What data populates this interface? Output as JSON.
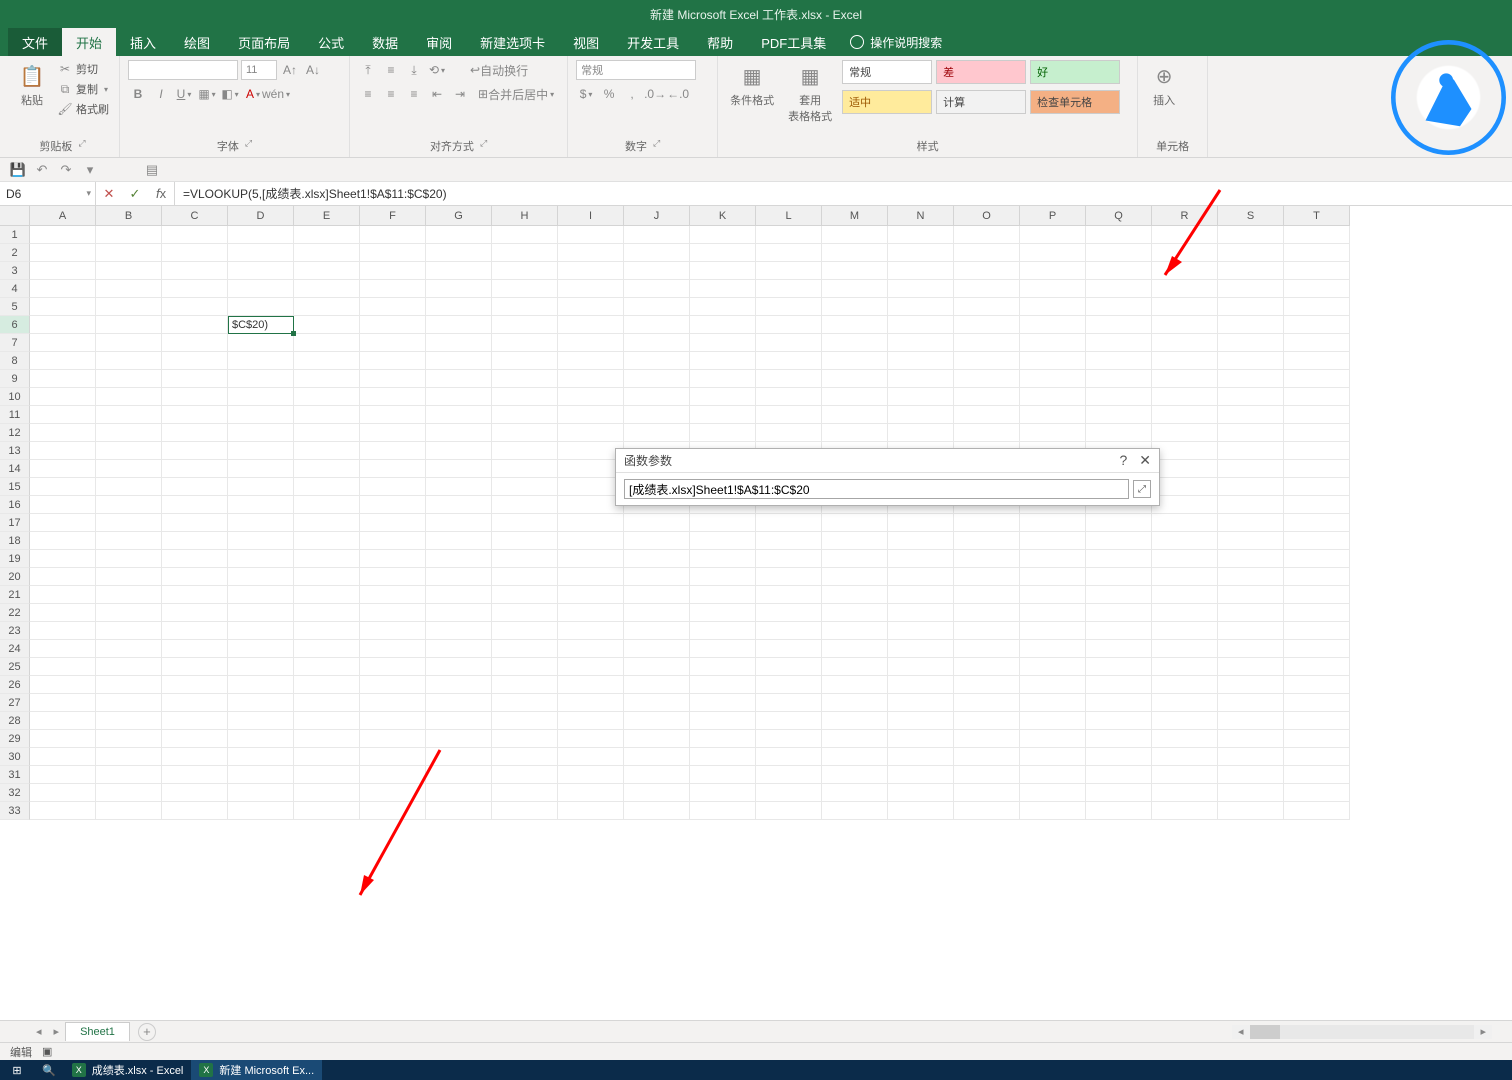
{
  "title": "新建 Microsoft Excel 工作表.xlsx  -  Excel",
  "tabs": {
    "file": "文件",
    "home": "开始",
    "insert": "插入",
    "draw": "绘图",
    "layout": "页面布局",
    "formulas": "公式",
    "data": "数据",
    "review": "审阅",
    "newtab": "新建选项卡",
    "view": "视图",
    "dev": "开发工具",
    "help": "帮助",
    "pdf": "PDF工具集",
    "tellme": "操作说明搜索"
  },
  "ribbon": {
    "clipboard": {
      "paste": "粘贴",
      "cut": "剪切",
      "copy": "复制",
      "format_painter": "格式刷",
      "label": "剪贴板"
    },
    "font": {
      "label": "字体",
      "size": "11"
    },
    "align": {
      "label": "对齐方式",
      "wrap": "自动换行",
      "merge": "合并后居中"
    },
    "number": {
      "label": "数字",
      "general": "常规"
    },
    "styles": {
      "label": "样式",
      "cond": "条件格式",
      "table": "套用\n表格格式",
      "normal": "常规",
      "bad": "差",
      "good": "好",
      "neutral": "适中",
      "calc": "计算",
      "check": "检查单元格"
    },
    "cells": {
      "label": "单元格",
      "insert": "插入"
    }
  },
  "namebox": "D6",
  "formula": "=VLOOKUP(5,[成绩表.xlsx]Sheet1!$A$11:$C$20)",
  "columns": [
    "A",
    "B",
    "C",
    "D",
    "E",
    "F",
    "G",
    "H",
    "I",
    "J",
    "K",
    "L",
    "M",
    "N",
    "O",
    "P",
    "Q",
    "R",
    "S",
    "T"
  ],
  "row_count": 33,
  "active_cell": {
    "row": 6,
    "col": "D",
    "display": "$C$20)"
  },
  "dialog": {
    "title": "函数参数",
    "value": "[成绩表.xlsx]Sheet1!$A$11:$C$20"
  },
  "sheet": {
    "name": "Sheet1"
  },
  "status": {
    "mode": "编辑"
  },
  "taskbar": {
    "item1": "成绩表.xlsx - Excel",
    "item2": "新建 Microsoft Ex..."
  }
}
